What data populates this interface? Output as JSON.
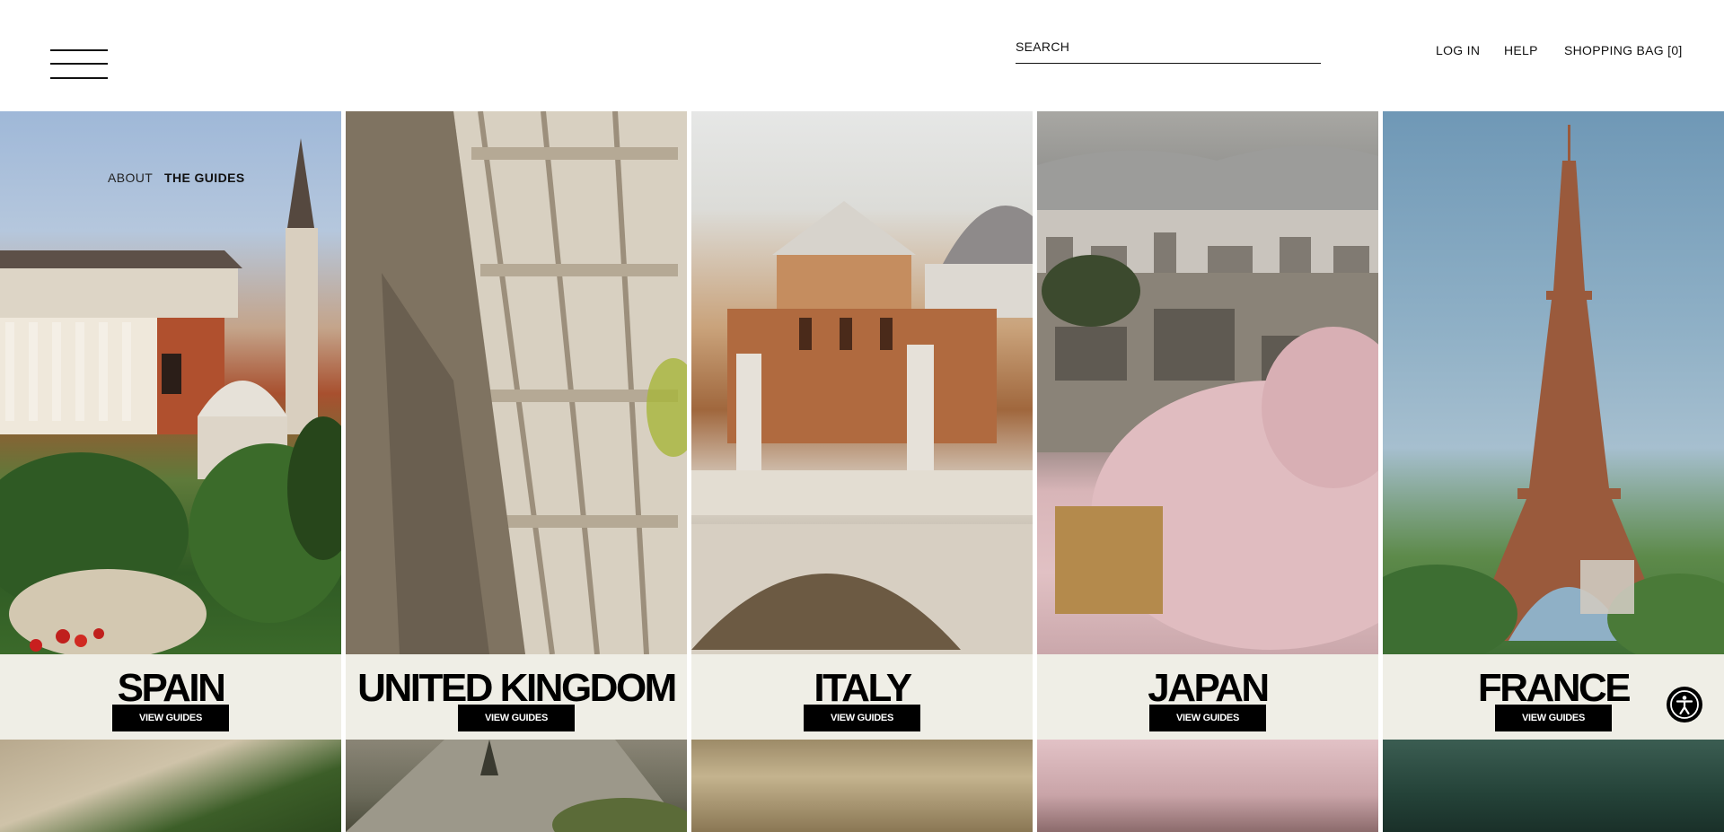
{
  "header": {
    "search_placeholder": "SEARCH",
    "login": "LOG IN",
    "help": "HELP",
    "shopping_bag": "SHOPPING BAG [0]"
  },
  "subnav": {
    "about": "ABOUT",
    "the_guides": "THE GUIDES"
  },
  "guides": [
    {
      "country": "SPAIN",
      "button": "VIEW GUIDES"
    },
    {
      "country": "UNITED KINGDOM",
      "button": "VIEW GUIDES"
    },
    {
      "country": "ITALY",
      "button": "VIEW GUIDES"
    },
    {
      "country": "JAPAN",
      "button": "VIEW GUIDES"
    },
    {
      "country": "FRANCE",
      "button": "VIEW GUIDES"
    }
  ],
  "icons": {
    "menu": "hamburger-menu-icon",
    "accessibility": "accessibility-icon"
  },
  "colors": {
    "band": "#efeee6",
    "button_bg": "#000000",
    "button_text": "#ffffff"
  }
}
